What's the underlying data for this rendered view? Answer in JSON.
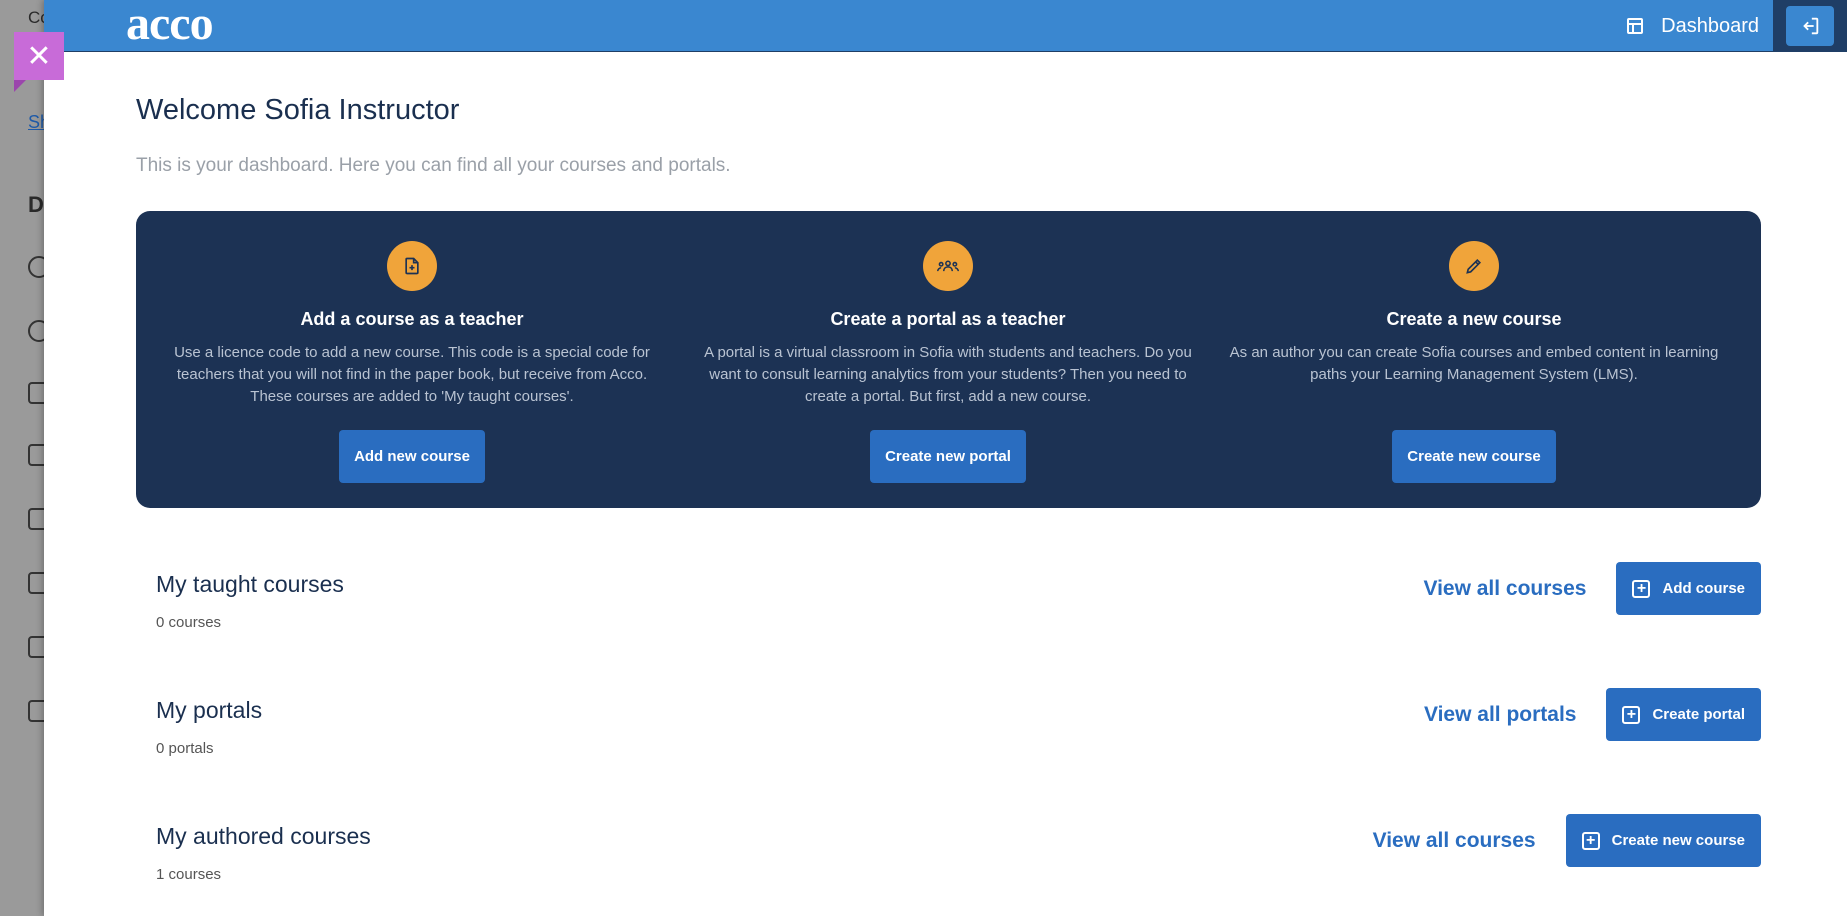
{
  "background": {
    "top_text": "Co",
    "link_text": "Sh",
    "section_letter": "D"
  },
  "header": {
    "logo_text": "acco",
    "dashboard_label": "Dashboard"
  },
  "welcome": {
    "title": "Welcome Sofia Instructor",
    "subtitle": "This is your dashboard. Here you can find all your courses and portals."
  },
  "hero": {
    "cards": [
      {
        "title": "Add a course as a teacher",
        "description": "Use a licence code to add a new course. This code is a special code for teachers that you will not find in the paper book, but receive from Acco. These courses are added to 'My taught courses'.",
        "button": "Add new course",
        "icon": "file-plus-icon"
      },
      {
        "title": "Create a portal as a teacher",
        "description": "A portal is a virtual classroom in Sofia with students and teachers. Do you want to consult learning analytics from your students? Then you need to create a portal. But first, add a new course.",
        "button": "Create new portal",
        "icon": "users-group-icon"
      },
      {
        "title": "Create a new course",
        "description": "As an author you can create Sofia courses and embed content in learning paths your Learning Management System (LMS).",
        "button": "Create new course",
        "icon": "pencil-icon"
      }
    ]
  },
  "sections": {
    "taught": {
      "title": "My taught courses",
      "count": "0 courses",
      "view_label": "View all courses",
      "action_label": "Add course"
    },
    "portals": {
      "title": "My portals",
      "count": "0 portals",
      "view_label": "View all portals",
      "action_label": "Create portal"
    },
    "authored": {
      "title": "My authored courses",
      "count": "1 courses",
      "view_label": "View all courses",
      "action_label": "Create new course"
    }
  },
  "colors": {
    "header": "#3a87d0",
    "hero_bg": "#1c3254",
    "accent_icon": "#f0a43a",
    "button": "#2a6dc0",
    "close_tab": "#c86bd8"
  }
}
